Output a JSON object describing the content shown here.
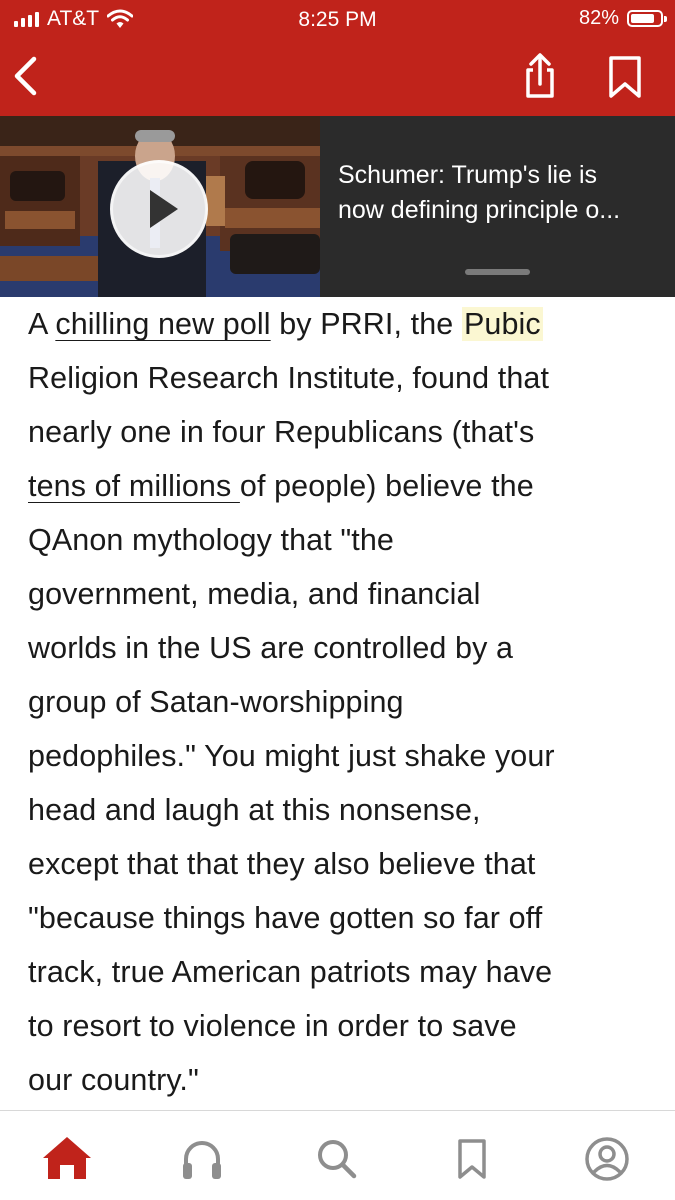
{
  "status_bar": {
    "carrier": "AT&T",
    "time": "8:25 PM",
    "battery": "82%",
    "battery_level": 0.82
  },
  "nav": {
    "back_icon": "chevron-left-icon",
    "share_icon": "share-icon",
    "bookmark_icon": "bookmark-icon"
  },
  "video": {
    "title_line1": "Schumer: Trump's lie is",
    "title_line2": "now defining principle o..."
  },
  "article": {
    "l1_a": "A ",
    "l1_link": "chilling new poll",
    "l1_b": " by PRRI, the ",
    "l1_hl": "Pubic",
    "l2": "Religion Research Institute, found that",
    "l3": "nearly one in four Republicans (that's",
    "l4_link": "tens of millions ",
    "l4_b": "of people) believe the",
    "l5": "QAnon mythology that \"the",
    "l6": "government, media, and financial",
    "l7": "worlds in the US are controlled by a",
    "l8": "group of Satan-worshipping",
    "l9": "pedophiles.\" You might just shake your",
    "l10": "head and laugh at this nonsense,",
    "l11": "except that that they also believe that",
    "l12": "\"because things have gotten so far off",
    "l13": "track, true American patriots may have",
    "l14": "to resort to violence in order to save",
    "l15": "our country.\""
  },
  "tabs": [
    {
      "icon": "home-icon",
      "active": true
    },
    {
      "icon": "headphones-icon",
      "active": false
    },
    {
      "icon": "search-icon",
      "active": false
    },
    {
      "icon": "bookmark-icon",
      "active": false
    },
    {
      "icon": "profile-icon",
      "active": false
    }
  ],
  "colors": {
    "brand": "#c0231b",
    "highlight": "#fbf7d2",
    "tab_inactive": "#8e8e8e"
  }
}
